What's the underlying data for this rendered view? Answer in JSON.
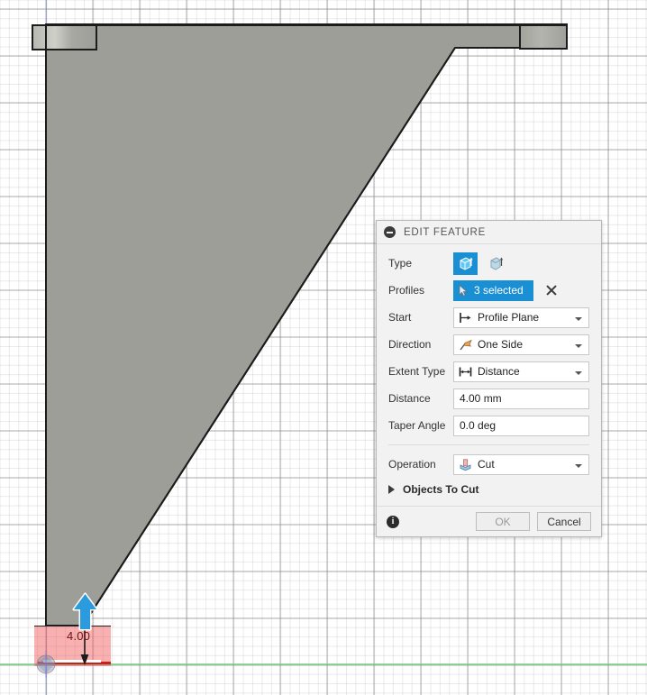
{
  "app": {
    "viewport_name": "cad-3d-viewport"
  },
  "palette": {
    "title": "EDIT FEATURE",
    "collapse_icon": "minus-circle-icon",
    "rows": {
      "type": {
        "label": "Type",
        "options": [
          "extrude-straight-icon",
          "extrude-tapered-icon"
        ],
        "selected_index": 0
      },
      "profiles": {
        "label": "Profiles",
        "value": "3 selected",
        "cursor_icon": "selection-cursor-icon",
        "clear_icon": "close-x-icon"
      },
      "start": {
        "label": "Start",
        "value": "Profile Plane",
        "icon": "profile-plane-icon"
      },
      "direction": {
        "label": "Direction",
        "value": "One Side",
        "icon": "one-side-flag-icon"
      },
      "extent_type": {
        "label": "Extent Type",
        "value": "Distance",
        "icon": "distance-measure-icon"
      },
      "distance": {
        "label": "Distance",
        "value": "4.00 mm",
        "placeholder": "4.00 mm"
      },
      "taper_angle": {
        "label": "Taper Angle",
        "value": "0.0 deg",
        "placeholder": "0.0 deg"
      },
      "operation": {
        "label": "Operation",
        "value": "Cut",
        "icon": "cut-operation-icon"
      }
    },
    "objects_to_cut": {
      "label": "Objects To Cut",
      "expand_icon": "triangle-right-icon",
      "expanded": false
    },
    "footer": {
      "info_icon": "info-icon",
      "info_glyph": "i",
      "ok_label": "OK",
      "cancel_label": "Cancel",
      "ok_enabled": false
    }
  },
  "viewport": {
    "dimension": {
      "value": "4.00",
      "name": "extrude-distance-dimension"
    },
    "manipulator": {
      "name": "extrude-direction-arrow",
      "color": "#1b8fd4"
    },
    "origin": {
      "name": "origin-marker"
    },
    "colors": {
      "body_face": "#9e9e99",
      "body_edge": "#1c1c1c",
      "highlight_red": "#f05050",
      "axis_green": "#6ecd78",
      "axis_blue": "#7882d7",
      "accent_blue": "#1b8fd4"
    }
  }
}
